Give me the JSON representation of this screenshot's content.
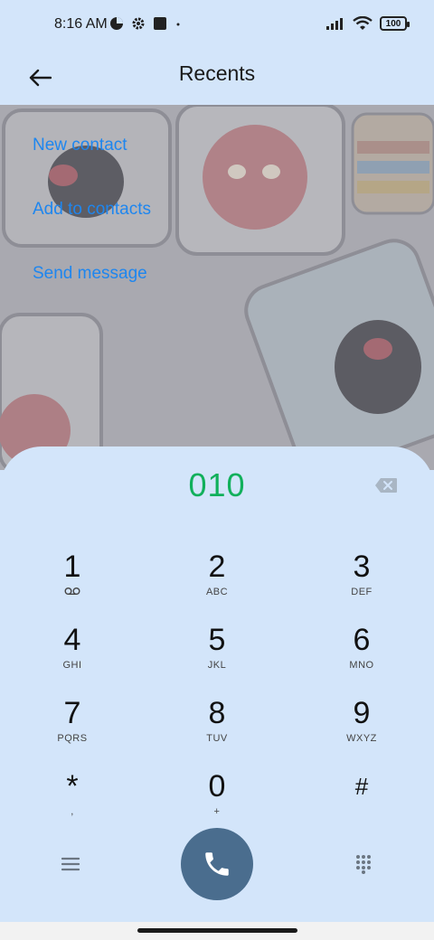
{
  "status_bar": {
    "time": "8:16 AM",
    "battery": "100",
    "icons": [
      "data-saver-icon",
      "settings-icon",
      "square-notification-icon",
      "dot-icon",
      "signal-icon",
      "wifi-icon",
      "battery-icon"
    ]
  },
  "app_bar": {
    "title": "Recents",
    "back_icon": "arrow-left-icon"
  },
  "actions": [
    {
      "label": "New contact"
    },
    {
      "label": "Add to contacts"
    },
    {
      "label": "Send message"
    }
  ],
  "dialpad": {
    "number": "010",
    "number_color": "#11b05b",
    "keys": [
      {
        "digit": "1",
        "letters": "",
        "icon": "voicemail-icon"
      },
      {
        "digit": "2",
        "letters": "ABC"
      },
      {
        "digit": "3",
        "letters": "DEF"
      },
      {
        "digit": "4",
        "letters": "GHI"
      },
      {
        "digit": "5",
        "letters": "JKL"
      },
      {
        "digit": "6",
        "letters": "MNO"
      },
      {
        "digit": "7",
        "letters": "PQRS"
      },
      {
        "digit": "8",
        "letters": "TUV"
      },
      {
        "digit": "9",
        "letters": "WXYZ"
      },
      {
        "digit": "*",
        "letters": ","
      },
      {
        "digit": "0",
        "letters": "+"
      },
      {
        "digit": "#",
        "letters": ""
      }
    ]
  },
  "colors": {
    "background": "#d3e5fa",
    "link": "#1e86ef",
    "call_button": "#4a6d8e"
  }
}
